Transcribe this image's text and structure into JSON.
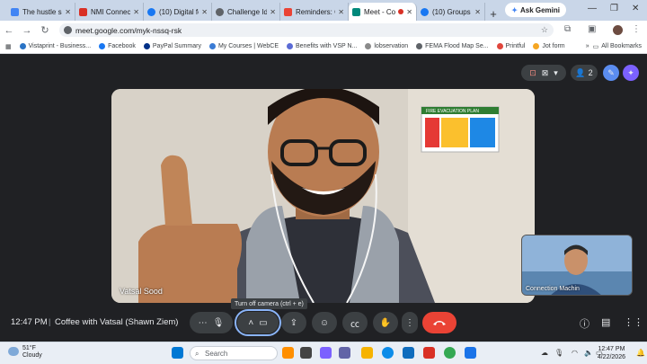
{
  "browser": {
    "tabs": [
      {
        "title": "The hustle so...",
        "color": "#4285f4"
      },
      {
        "title": "NMI Connect",
        "color": "#d93025"
      },
      {
        "title": "(10) Digital fo",
        "color": "#1877f2"
      },
      {
        "title": "Challenge Ide",
        "color": "#5f6368"
      },
      {
        "title": "Reminders: Co",
        "color": "#ea4335"
      },
      {
        "title": "Meet - Co",
        "color": "#00897b",
        "active": true
      },
      {
        "title": "(10) Groups |",
        "color": "#1877f2"
      }
    ],
    "new_tab_label": "+",
    "ask_gemini_label": "Ask Gemini",
    "url": "meet.google.com/myk-nssq-rsk",
    "bookmarks": [
      {
        "label": "Vistaprint - Business...",
        "color": "#2a73c5"
      },
      {
        "label": "Facebook",
        "color": "#1877f2"
      },
      {
        "label": "PayPal Summary",
        "color": "#003087"
      },
      {
        "label": "My Courses | WebCE",
        "color": "#3a7bd5"
      },
      {
        "label": "Benefits with VSP N...",
        "color": "#5b6bd5"
      },
      {
        "label": "lobservation",
        "color": "#8a8a8a"
      },
      {
        "label": "FEMA Flood Map Se...",
        "color": "#5f6368"
      },
      {
        "label": "Printful",
        "color": "#e0463c"
      },
      {
        "label": "Jot form",
        "color": "#f5a623"
      }
    ],
    "all_bookmarks_label": "All Bookmarks"
  },
  "meet": {
    "participant_count": "2",
    "main_participant": "Vatsal Sood",
    "self_participant": "Connection Machin",
    "tooltip": "Turn off camera (ctrl + e)",
    "time": "12:47 PM",
    "separator": "|",
    "meeting_title": "Coffee with Vatsal (Shawn Ziem)",
    "poster_title": "FIRE EVACUATION PLAN"
  },
  "taskbar": {
    "temperature": "51°F",
    "condition": "Cloudy",
    "search_placeholder": "Search",
    "clock_time": "12:47 PM",
    "clock_date": "4/22/2026"
  },
  "colors": {
    "meet_bg": "#202124",
    "control_bg": "#3c4043",
    "end_call": "#ea4335",
    "accent": "#8ab4f8"
  }
}
